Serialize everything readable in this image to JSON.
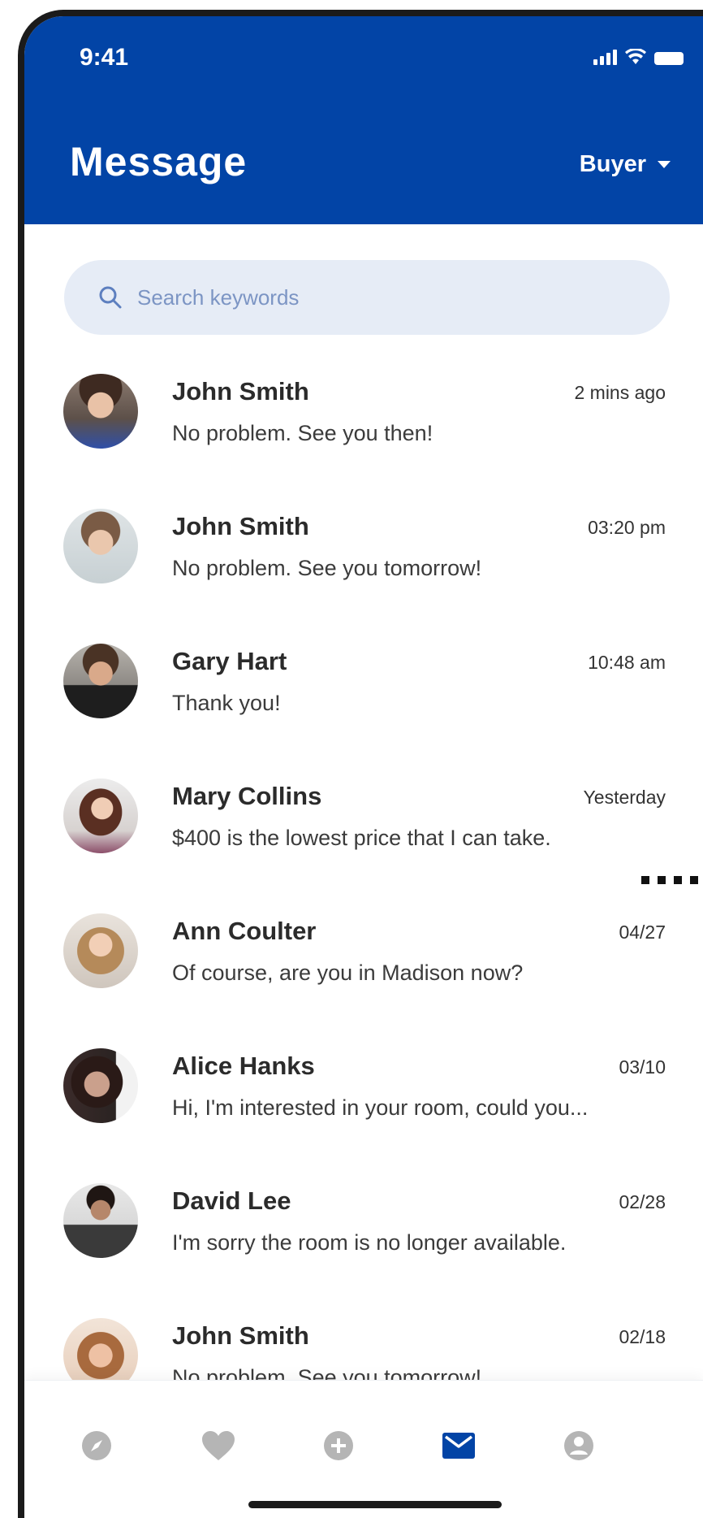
{
  "status_bar": {
    "time": "9:41"
  },
  "header": {
    "title": "Message",
    "role": "Buyer"
  },
  "search": {
    "placeholder": "Search keywords"
  },
  "conversations": [
    {
      "name": "John Smith",
      "preview": "No problem. See you then!",
      "time": "2 mins ago"
    },
    {
      "name": "John Smith",
      "preview": "No problem. See you tomorrow!",
      "time": "03:20 pm"
    },
    {
      "name": "Gary Hart",
      "preview": "Thank you!",
      "time": "10:48 am"
    },
    {
      "name": "Mary Collins",
      "preview": "$400 is the lowest price that I can take.",
      "time": "Yesterday"
    },
    {
      "name": "Ann Coulter",
      "preview": "Of course, are you in Madison now?",
      "time": "04/27"
    },
    {
      "name": "Alice Hanks",
      "preview": "Hi, I'm interested in your room, could you...",
      "time": "03/10"
    },
    {
      "name": "David Lee",
      "preview": "I'm sorry the room is no longer available.",
      "time": "02/28"
    },
    {
      "name": "John Smith",
      "preview": "No problem. See you tomorrow!",
      "time": "02/18"
    }
  ],
  "tabbar": {
    "items": [
      {
        "icon": "compass-icon",
        "active": false
      },
      {
        "icon": "heart-icon",
        "active": false
      },
      {
        "icon": "plus-circle-icon",
        "active": false
      },
      {
        "icon": "mail-icon",
        "active": true
      },
      {
        "icon": "user-icon",
        "active": false
      }
    ]
  },
  "colors": {
    "brand": "#0244a6",
    "search_bg": "#e6ecf6",
    "inactive_icon": "#b5b5b5"
  }
}
